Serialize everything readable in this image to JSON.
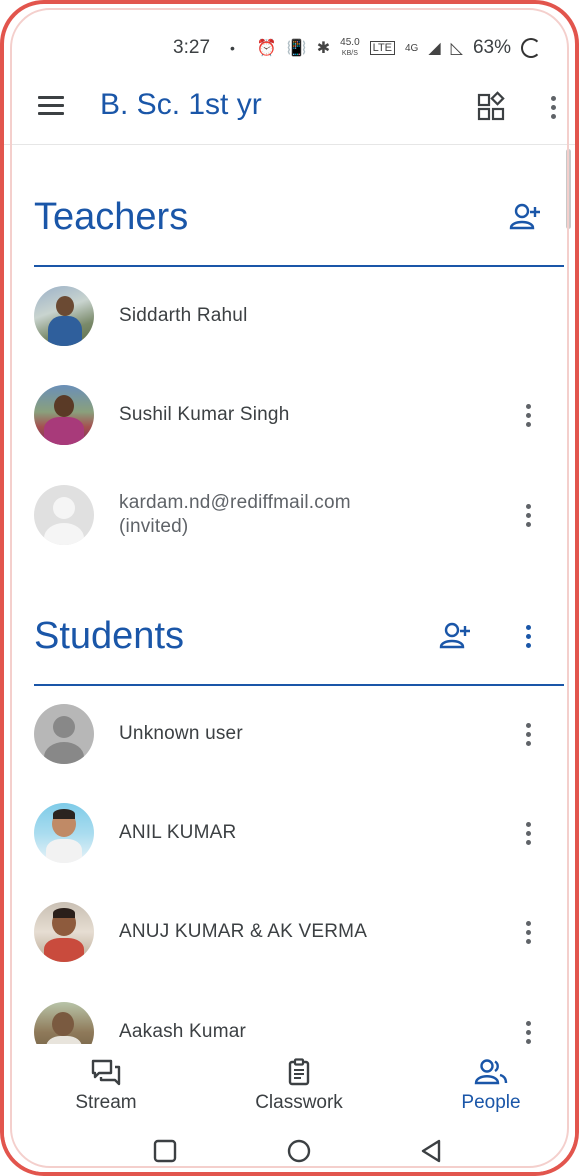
{
  "status_bar": {
    "time": "3:27",
    "separator": "•",
    "speed_value": "45.0",
    "speed_unit": "KB/S",
    "network": "4G",
    "battery": "63%"
  },
  "app_bar": {
    "title": "B. Sc. 1st yr"
  },
  "teachers": {
    "title": "Teachers",
    "rows": [
      {
        "name": "Siddarth Rahul",
        "avatar": "photo",
        "has_menu": false
      },
      {
        "name": "Sushil Kumar Singh",
        "avatar": "photo",
        "has_menu": true
      },
      {
        "name": "kardam.nd@rediffmail.com",
        "subtitle": "(invited)",
        "avatar": "placeholder",
        "has_menu": true
      }
    ]
  },
  "students": {
    "title": "Students",
    "rows": [
      {
        "name": "Unknown user",
        "avatar": "placeholder",
        "has_menu": true
      },
      {
        "name": "ANIL KUMAR",
        "avatar": "photo",
        "has_menu": true
      },
      {
        "name": "ANUJ KUMAR & AK VERMA",
        "avatar": "photo",
        "has_menu": true
      },
      {
        "name": "Aakash Kumar",
        "avatar": "photo",
        "has_menu": true
      }
    ]
  },
  "bottom_nav": [
    {
      "label": "Stream",
      "icon": "stream-icon",
      "active": false
    },
    {
      "label": "Classwork",
      "icon": "classwork-icon",
      "active": false
    },
    {
      "label": "People",
      "icon": "people-icon",
      "active": true
    }
  ],
  "colors": {
    "accent": "#1a56a8",
    "text": "#3c4043",
    "frame": "#e2554d"
  }
}
